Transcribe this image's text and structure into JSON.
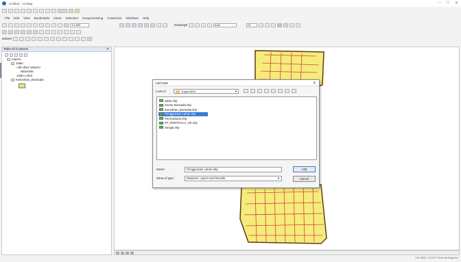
{
  "window": {
    "title": "Untitled - ArcMap",
    "controls": [
      "–",
      "□",
      "✕"
    ]
  },
  "menu": [
    "File",
    "Edit",
    "View",
    "Bookmarks",
    "Insert",
    "Selection",
    "Geoprocessing",
    "Customize",
    "Windows",
    "Help"
  ],
  "toolbar": {
    "scale": "1:4,900",
    "editor_label": "Editor▾",
    "drawing_label": "Drawing▾",
    "font": "Arial",
    "font_size": "10"
  },
  "toc": {
    "title": "Table Of Contents",
    "tree": [
      {
        "label": "Layers",
        "level": 1
      },
      {
        "label": "Jalan",
        "level": 2
      },
      {
        "label": "<all other values>",
        "level": 3
      },
      {
        "label": "REMARK",
        "level": 4
      },
      {
        "label": "Jalan Lokal",
        "level": 3
      },
      {
        "label": "Kelurahan_Bontoala",
        "level": 2
      }
    ]
  },
  "dialog": {
    "title": "Add Data",
    "look_in_label": "Look in:",
    "look_in_value": "Tugas Akhir",
    "files": [
      "Jalan.shp",
      "Kontur Bontoala.shp",
      "Kelurahan_Bontoala.shp",
      "Penggunaan Lahan.shp",
      "Permukiman.shp",
      "RT_BONTOALA_UK.shp",
      "Sungai.shp"
    ],
    "selected_index": 3,
    "name_label": "Name:",
    "name_value": "Penggunaan Lahan.shp",
    "type_label": "Show of type:",
    "type_value": "Datasets, Layers and Results",
    "add_label": "Add",
    "cancel_label": "Cancel"
  },
  "status": {
    "coords": "119.4282 -5.1267 Decimal Degrees"
  },
  "colors": {
    "map_outline": "#5a3d10",
    "map_fill": "#f6ec7a",
    "roads": "#d04040",
    "selection": "#3a7bd5"
  }
}
